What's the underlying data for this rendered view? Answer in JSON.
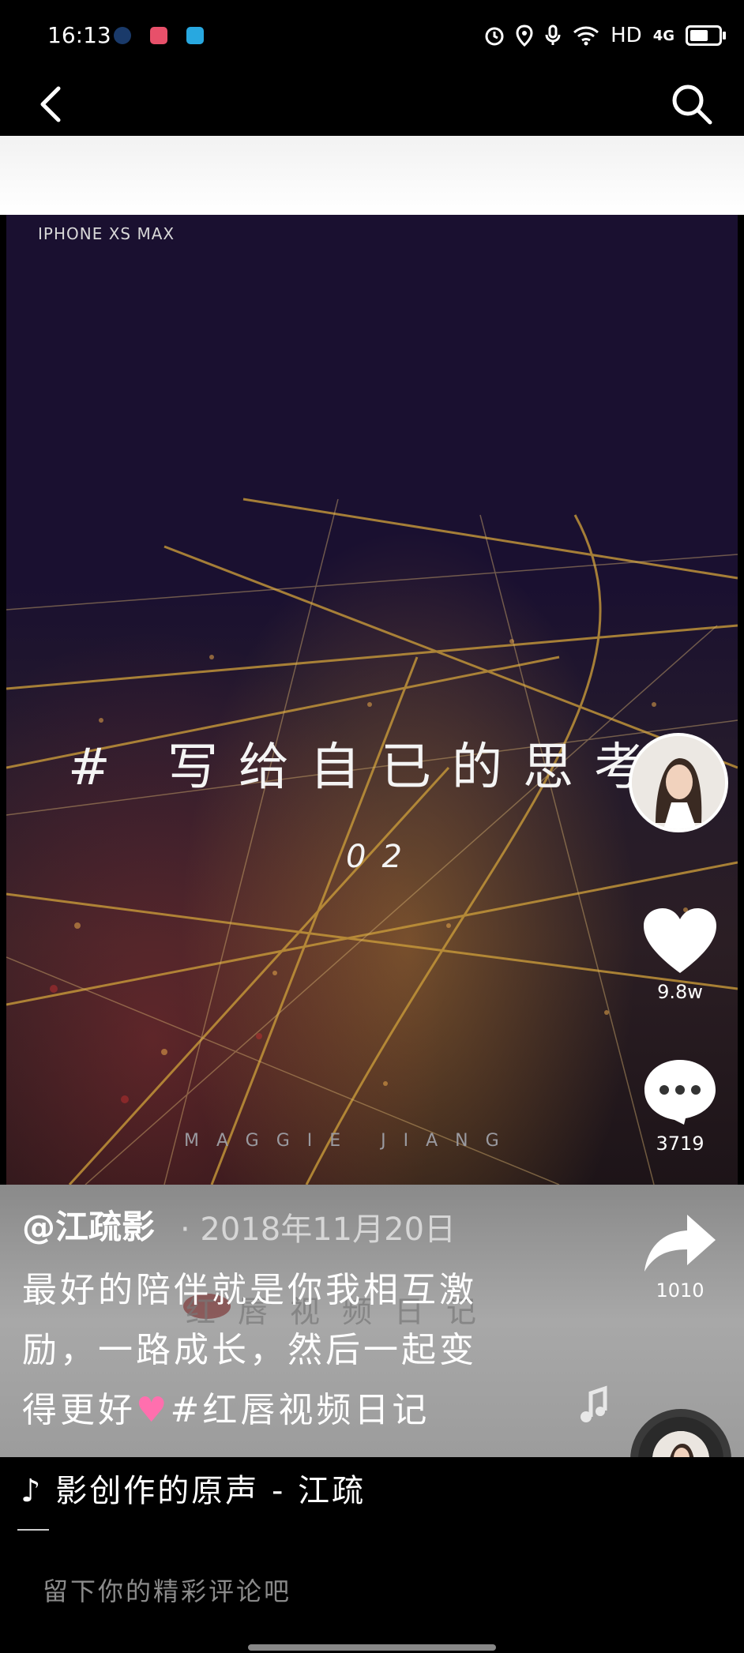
{
  "status_bar": {
    "time": "16:13",
    "network_label": "HD",
    "signal_label": "4G",
    "icons": [
      "qq-icon",
      "app-icon-red",
      "app-icon-blue",
      "alarm-icon",
      "location-icon",
      "mic-icon",
      "wifi-icon",
      "signal-icon",
      "battery-icon"
    ]
  },
  "top_bar": {
    "back_icon": "chevron-left-icon",
    "search_icon": "search-icon"
  },
  "video": {
    "watermark_top": "IPHONE XS MAX",
    "headline": "# 写给自已的思考",
    "episode": "02",
    "watermark_bottom": "MAGGIE JIANG"
  },
  "actions": {
    "likes": "9.8w",
    "comments": "3719",
    "shares": "1010"
  },
  "post": {
    "author": "@江疏影",
    "date": "· 2018年11月20日",
    "desc_line1": "最好的陪伴就是你我相互激",
    "desc_line2": "励，一路成长，然后一起变",
    "desc_line3a": "得更好",
    "desc_line3b": "#红唇视频日记",
    "overlay_mark": "红唇视频日记",
    "music": "♪ 影创作的原声 - 江疏",
    "comment_placeholder": "留下你的精彩评论吧"
  },
  "colors": {
    "heart": "#ff6fae",
    "background": "#000000"
  }
}
